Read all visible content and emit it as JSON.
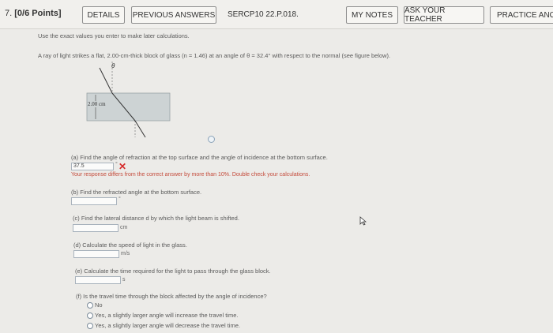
{
  "header": {
    "question_number": "7.",
    "points": "[0/6 Points]",
    "details_label": "DETAILS",
    "previous_answers_label": "PREVIOUS ANSWERS",
    "problem_code": "SERCP10 22.P.018.",
    "my_notes_label": "MY NOTES",
    "ask_teacher_label": "ASK YOUR TEACHER",
    "practice_label": "PRACTICE ANOTHER"
  },
  "instructions": "Use the exact values you enter to make later calculations.",
  "problem": "A ray of light strikes a flat, 2.00-cm-thick block of glass (n = 1.46) at an angle of θ = 32.4° with respect to the normal (see figure below).",
  "figure": {
    "theta_label": "θ",
    "thickness_label": "2.00 cm"
  },
  "parts": {
    "a": {
      "prompt": "(a) Find the angle of refraction at the top surface and the angle of incidence at the bottom surface.",
      "answer": "37.5",
      "feedback": "Your response differs from the correct answer by more than 10%. Double check your calculations.",
      "unit": "°"
    },
    "b": {
      "prompt": "(b) Find the refracted angle at the bottom surface.",
      "unit": "°"
    },
    "c": {
      "prompt": "(c) Find the lateral distance d by which the light beam is shifted.",
      "unit": "cm"
    },
    "d": {
      "prompt": "(d) Calculate the speed of light in the glass.",
      "unit": "m/s"
    },
    "e": {
      "prompt": "(e) Calculate the time required for the light to pass through the glass block.",
      "unit": "s"
    },
    "f": {
      "prompt": "(f) Is the travel time through the block affected by the angle of incidence?",
      "options": [
        "No",
        "Yes, a slightly larger angle will increase the travel time.",
        "Yes, a slightly larger angle will decrease the travel time."
      ]
    }
  },
  "colors": {
    "accent": "#7a9bbf",
    "error": "#d62b2b",
    "feedback": "#c44a3a"
  }
}
